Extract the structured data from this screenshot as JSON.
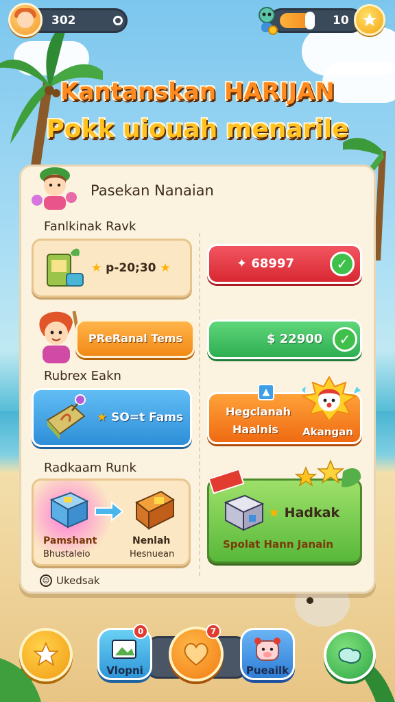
{
  "hud": {
    "coins": "302",
    "energy": "10",
    "energy_fill": 0.8,
    "coin_icon": "star-icon"
  },
  "title": {
    "line1": "Kantanskan HARIJAN",
    "line2": "Pokk uiouah menarile"
  },
  "panel": {
    "header": "Pasekan Nanaian",
    "footer": "Ukedsak",
    "sections": [
      {
        "label": "Fanlkinak Ravk"
      },
      {
        "label": "Rubrex Eakn"
      },
      {
        "label": "Radkaam Runk"
      }
    ],
    "cards": {
      "reward_a": "p-20;30",
      "reward_a_btn": "68997",
      "reward_b_btn": "PReRanal Tems",
      "reward_b_price": "$ 22900",
      "reward_c": "SO=t Fams",
      "reward_c_right_l1": "Hegclanah",
      "reward_c_right_l2": "Haalnis",
      "reward_c_right_tag": "Akangan",
      "reward_d_l1": "Pamshant",
      "reward_d_l2": "Bhustaleio",
      "reward_d_r1": "Nenlah",
      "reward_d_r2": "Hesnuean",
      "reward_e_title": "Hadkak",
      "reward_e_sub": "Spolat Hann Janain"
    }
  },
  "nav": {
    "items": [
      {
        "label": "",
        "icon": "star-icon"
      },
      {
        "label": "Vlopni",
        "icon": "photo-icon",
        "badge": "0"
      },
      {
        "label": "",
        "icon": "heart-icon",
        "badge": "7"
      },
      {
        "label": "Pueailk",
        "icon": "pig-icon"
      },
      {
        "label": "",
        "icon": "map-icon"
      }
    ]
  },
  "colors": {
    "accent_orange": "#ff8a1f",
    "title_yellow": "#ffc21f",
    "green_btn": "#3fbf5e",
    "red_btn": "#e8343c",
    "blue_btn": "#3e9ee6"
  }
}
